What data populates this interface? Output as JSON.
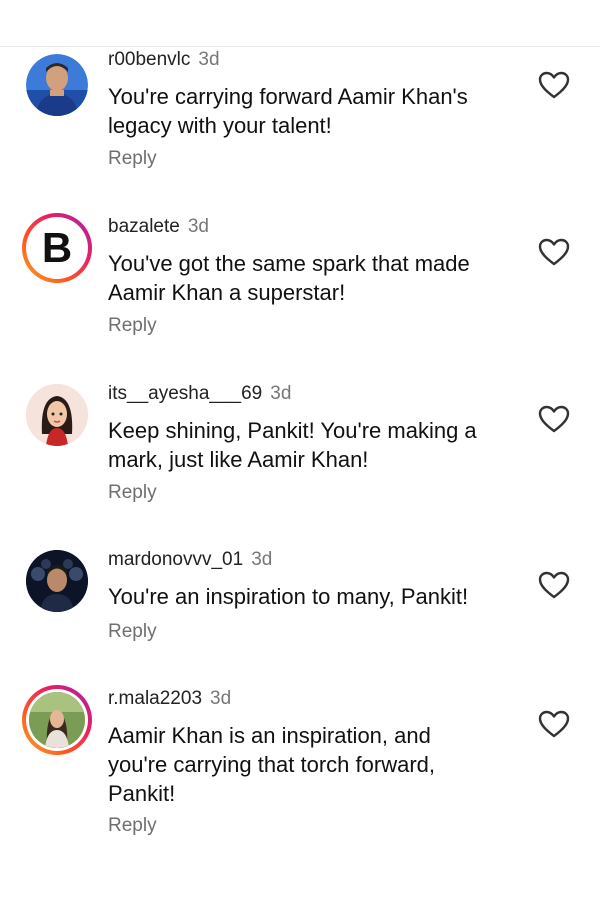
{
  "comments": [
    {
      "username": "r00benvlc",
      "time": "3d",
      "text_lines": [
        "You're carrying forward Aamir Khan's",
        "legacy with your talent!"
      ],
      "reply_label": "Reply",
      "avatar": "person-photo-blue"
    },
    {
      "username": "bazalete",
      "time": "3d",
      "text_lines": [
        "You've got the same spark that made",
        "Aamir Khan a superstar!"
      ],
      "reply_label": "Reply",
      "avatar": "letter-b-logo",
      "avatar_letter": "B"
    },
    {
      "username": "its__ayesha___69",
      "time": "3d",
      "text_lines": [
        "Keep shining, Pankit! You're making a",
        "mark, just like Aamir Khan!"
      ],
      "reply_label": "Reply",
      "avatar": "cartoon-girl-illustration"
    },
    {
      "username": "mardonovvv_01",
      "time": "3d",
      "text_lines": [
        "You're an inspiration to many, Pankit!"
      ],
      "reply_label": "Reply",
      "avatar": "group-photo-dark"
    },
    {
      "username": "r.mala2203",
      "time": "3d",
      "text_lines": [
        "Aamir Khan is an inspiration, and",
        "you're carrying that torch forward,",
        "Pankit!"
      ],
      "reply_label": "Reply",
      "avatar": "woman-photo-outdoor"
    }
  ],
  "colors": {
    "story_ring": "#e91e63",
    "muted_text": "#777777"
  }
}
